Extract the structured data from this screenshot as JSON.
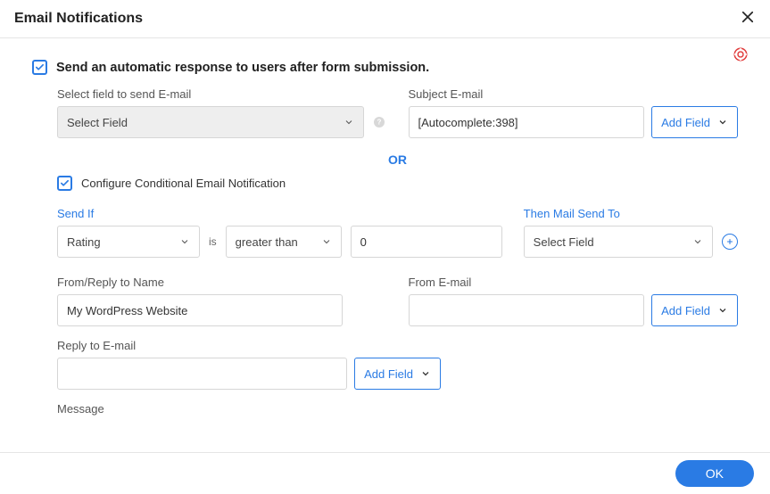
{
  "header": {
    "title": "Email Notifications"
  },
  "auto_response": {
    "checked": true,
    "label": "Send an automatic response to users after form submission.",
    "select_field_label": "Select field to send E-mail",
    "select_field_value": "Select Field",
    "subject_label": "Subject E-mail",
    "subject_value": "[Autocomplete:398]",
    "add_field_btn": "Add Field"
  },
  "divider": {
    "or": "OR"
  },
  "conditional": {
    "checked": true,
    "label": "Configure Conditional Email Notification",
    "send_if_label": "Send If",
    "is_text": "is",
    "field_value": "Rating",
    "operator_value": "greater than",
    "compare_value": "0",
    "then_label": "Then Mail Send To",
    "then_value": "Select Field"
  },
  "from": {
    "reply_name_label": "From/Reply to Name",
    "reply_name_value": "My WordPress Website",
    "from_email_label": "From E-mail",
    "from_email_value": "",
    "add_field_btn": "Add Field",
    "reply_email_label": "Reply to E-mail",
    "reply_email_value": "",
    "add_field_btn2": "Add Field"
  },
  "message": {
    "label": "Message"
  },
  "footer": {
    "ok": "OK"
  }
}
